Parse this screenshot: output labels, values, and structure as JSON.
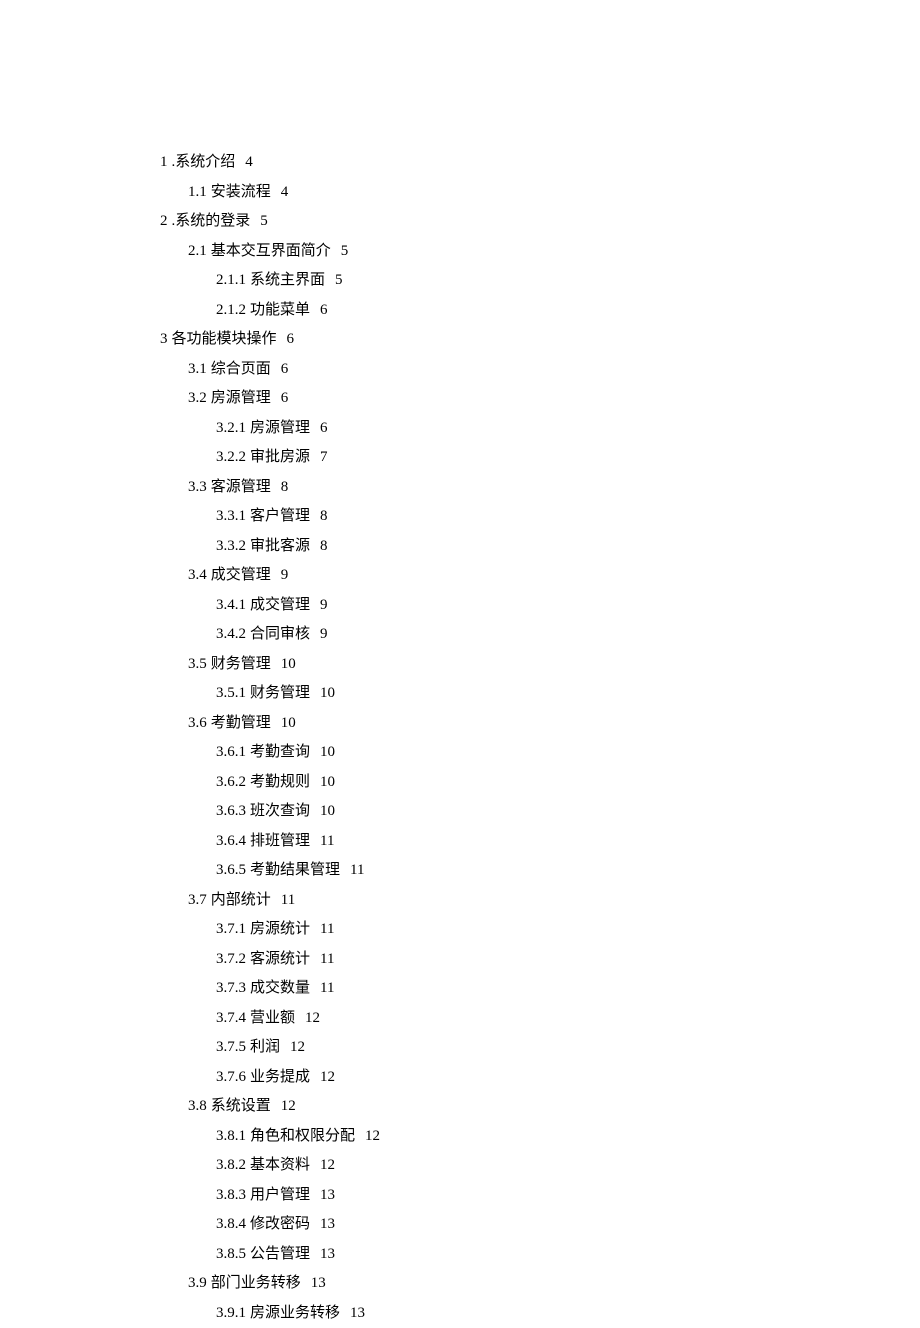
{
  "toc": [
    {
      "level": 1,
      "num": "1",
      "title": ".系统介绍",
      "page": "4"
    },
    {
      "level": 2,
      "num": "1.1",
      "title": "安装流程",
      "page": "4"
    },
    {
      "level": 1,
      "num": "2",
      "title": ".系统的登录",
      "page": "5"
    },
    {
      "level": 2,
      "num": "2.1",
      "title": "基本交互界面简介",
      "page": "5"
    },
    {
      "level": 3,
      "num": "2.1.1",
      "title": "系统主界面",
      "page": "5"
    },
    {
      "level": 3,
      "num": "2.1.2",
      "title": "功能菜单",
      "page": "6"
    },
    {
      "level": 1,
      "num": "3",
      "title": "各功能模块操作",
      "page": "6"
    },
    {
      "level": 2,
      "num": "3.1",
      "title": "综合页面",
      "page": "6"
    },
    {
      "level": 2,
      "num": "3.2",
      "title": "房源管理",
      "page": "6"
    },
    {
      "level": 3,
      "num": "3.2.1",
      "title": "房源管理",
      "page": "6"
    },
    {
      "level": 3,
      "num": "3.2.2",
      "title": "审批房源",
      "page": "7"
    },
    {
      "level": 2,
      "num": "3.3",
      "title": "客源管理",
      "page": "8"
    },
    {
      "level": 3,
      "num": "3.3.1",
      "title": "客户管理",
      "page": "8"
    },
    {
      "level": 3,
      "num": "3.3.2",
      "title": "审批客源",
      "page": "8"
    },
    {
      "level": 2,
      "num": "3.4",
      "title": "成交管理",
      "page": "9"
    },
    {
      "level": 3,
      "num": "3.4.1",
      "title": "成交管理",
      "page": "9"
    },
    {
      "level": 3,
      "num": "3.4.2",
      "title": "合同审核",
      "page": "9"
    },
    {
      "level": 2,
      "num": "3.5",
      "title": "财务管理",
      "page": "10"
    },
    {
      "level": 3,
      "num": "3.5.1",
      "title": "财务管理",
      "page": "10"
    },
    {
      "level": 2,
      "num": "3.6",
      "title": "考勤管理",
      "page": "10"
    },
    {
      "level": 3,
      "num": "3.6.1",
      "title": "考勤查询",
      "page": "10"
    },
    {
      "level": 3,
      "num": "3.6.2",
      "title": "考勤规则",
      "page": "10"
    },
    {
      "level": 3,
      "num": "3.6.3",
      "title": "班次查询",
      "page": "10"
    },
    {
      "level": 3,
      "num": "3.6.4",
      "title": "排班管理",
      "page": "11"
    },
    {
      "level": 3,
      "num": "3.6.5",
      "title": "考勤结果管理",
      "page": "11"
    },
    {
      "level": 2,
      "num": "3.7",
      "title": "内部统计",
      "page": "11"
    },
    {
      "level": 3,
      "num": "3.7.1",
      "title": "房源统计",
      "page": "11"
    },
    {
      "level": 3,
      "num": "3.7.2",
      "title": "客源统计",
      "page": "11"
    },
    {
      "level": 3,
      "num": "3.7.3",
      "title": "成交数量",
      "page": "11"
    },
    {
      "level": 3,
      "num": "3.7.4",
      "title": "营业额",
      "page": "12"
    },
    {
      "level": 3,
      "num": "3.7.5",
      "title": "利润",
      "page": "12"
    },
    {
      "level": 3,
      "num": "3.7.6",
      "title": "业务提成",
      "page": "12"
    },
    {
      "level": 2,
      "num": "3.8",
      "title": "系统设置",
      "page": "12"
    },
    {
      "level": 3,
      "num": "3.8.1",
      "title": "角色和权限分配",
      "page": "12"
    },
    {
      "level": 3,
      "num": "3.8.2",
      "title": "基本资料",
      "page": "12"
    },
    {
      "level": 3,
      "num": "3.8.3",
      "title": "用户管理",
      "page": "13"
    },
    {
      "level": 3,
      "num": "3.8.4",
      "title": "修改密码",
      "page": "13"
    },
    {
      "level": 3,
      "num": "3.8.5",
      "title": "公告管理",
      "page": "13"
    },
    {
      "level": 2,
      "num": "3.9",
      "title": "部门业务转移",
      "page": "13"
    },
    {
      "level": 3,
      "num": "3.9.1",
      "title": "房源业务转移",
      "page": "13"
    }
  ]
}
